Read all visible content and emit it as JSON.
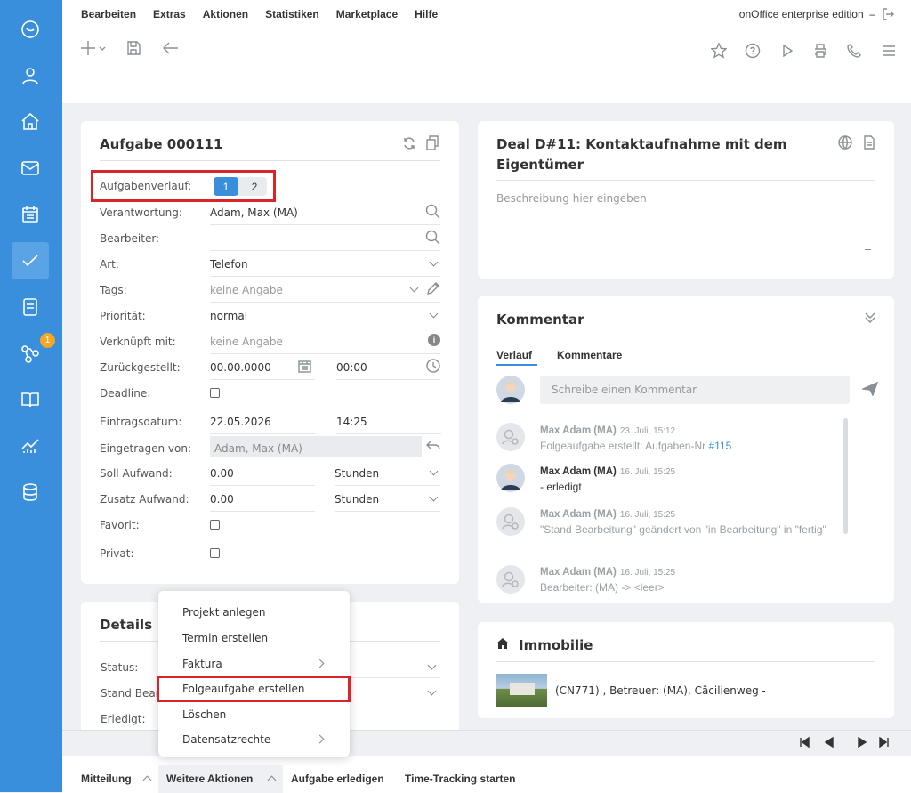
{
  "menu": {
    "items": [
      "Bearbeiten",
      "Extras",
      "Aktionen",
      "Statistiken",
      "Marketplace",
      "Hilfe"
    ],
    "edition": "onOffice enterprise edition",
    "dash": "–"
  },
  "sidebar": {
    "badge": "1"
  },
  "task": {
    "title": "Aufgabe 000111",
    "verlauf_label": "Aufgabenverlauf:",
    "verlauf_steps": [
      "1",
      "2"
    ],
    "fields": [
      {
        "label": "Verantwortung:",
        "value": "Adam, Max (MA)"
      },
      {
        "label": "Bearbeiter:",
        "value": ""
      },
      {
        "label": "Art:",
        "value": "Telefon"
      },
      {
        "label": "Tags:",
        "value": "keine Angabe"
      },
      {
        "label": "Priorität:",
        "value": "normal"
      },
      {
        "label": "Verknüpft mit:",
        "value": "keine Angabe"
      },
      {
        "label": "Zurückgestellt:",
        "value": "00.00.0000",
        "time": "00:00"
      },
      {
        "label": "Deadline:",
        "value": ""
      },
      {
        "label": "Eintragsdatum:",
        "value": "22.05.2026",
        "time": "14:25"
      },
      {
        "label": "Eingetragen von:",
        "value": "Adam, Max (MA)"
      },
      {
        "label": "Soll Aufwand:",
        "value": "0.00",
        "unit": "Stunden"
      },
      {
        "label": "Zusatz Aufwand:",
        "value": "0.00",
        "unit": "Stunden"
      },
      {
        "label": "Favorit:",
        "value": ""
      },
      {
        "label": "Privat:",
        "value": ""
      }
    ]
  },
  "deal": {
    "title": "Deal D#11: Kontaktaufnahme mit dem Eigentümer",
    "placeholder": "Beschreibung hier eingeben"
  },
  "kommentar": {
    "title": "Kommentar",
    "tabs": [
      "Verlauf",
      "Kommentare"
    ],
    "input_placeholder": "Schreibe einen Kommentar",
    "feed": [
      {
        "name": "Max Adam (MA)",
        "date": "23. Juli, 15:12",
        "text": "Folgeaufgabe erstellt: Aufgaben-Nr ",
        "link": "#115"
      },
      {
        "name": "Max Adam (MA)",
        "date": "16. Juli, 15:25",
        "text": "- erledigt"
      },
      {
        "name": "Max Adam (MA)",
        "date": "16. Juli, 15:25",
        "text": "\"Stand Bearbeitung\" geändert von \"in Bearbeitung\" in \"fertig\""
      },
      {
        "name": "Max Adam (MA)",
        "date": "16. Juli, 15:25",
        "text": "Bearbeiter: (MA) -> <leer>"
      }
    ]
  },
  "details": {
    "title": "Details",
    "fields": [
      "Status:",
      "Stand Bear",
      "Erledigt:"
    ]
  },
  "immobilie": {
    "title": "Immobilie",
    "text": "(CN771) , Betreuer: (MA), Cäcilienweg -"
  },
  "context_menu": {
    "items": [
      "Projekt anlegen",
      "Termin erstellen",
      "Faktura",
      "Folgeaufgabe erstellen",
      "Löschen",
      "Datensatzrechte"
    ]
  },
  "footer": {
    "buttons": [
      "Mitteilung",
      "Weitere Aktionen",
      "Aufgabe erledigen",
      "Time-Tracking starten"
    ]
  }
}
